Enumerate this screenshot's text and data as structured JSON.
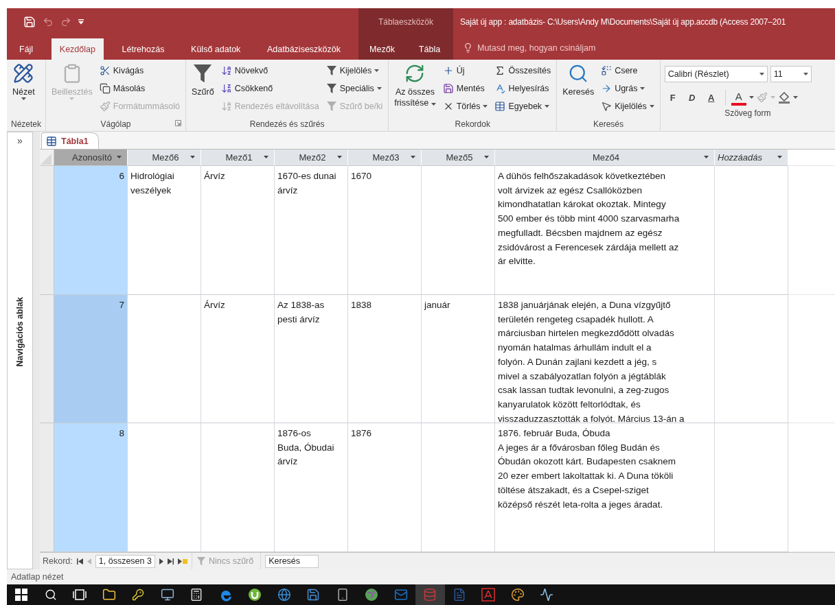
{
  "title_bar": {
    "context_label": "Táblaeszközök",
    "title": "Saját új app : adatbázis- C:\\Users\\Andy M\\Documents\\Saját új app.accdb (Access 2007–201"
  },
  "ribbon_tabs": [
    {
      "label": "Fájl",
      "selected": false,
      "kind": "normal"
    },
    {
      "label": "Kezdőlap",
      "selected": true,
      "kind": "normal"
    },
    {
      "label": "Létrehozás",
      "selected": false,
      "kind": "normal"
    },
    {
      "label": "Külső adatok",
      "selected": false,
      "kind": "normal"
    },
    {
      "label": "Adatbáziseszközök",
      "selected": false,
      "kind": "normal"
    },
    {
      "label": "Mezők",
      "selected": false,
      "kind": "context"
    },
    {
      "label": "Tábla",
      "selected": false,
      "kind": "context"
    }
  ],
  "tell_me": {
    "placeholder": "Mutasd meg, hogyan csináljam"
  },
  "ribbon_groups": [
    {
      "label": "Nézetek",
      "kind": "buttons",
      "launcher": false,
      "items": [
        {
          "label": "Nézet",
          "kind": "large",
          "disabled": false,
          "dropdown": true
        }
      ]
    },
    {
      "label": "Vágólap",
      "kind": "buttons",
      "launcher": true,
      "items": [
        {
          "label": "Beillesztés",
          "kind": "large",
          "disabled": true,
          "dropdown": true
        },
        {
          "label": "Kivágás",
          "kind": "small",
          "disabled": false
        },
        {
          "label": "Másolás",
          "kind": "small",
          "disabled": false
        },
        {
          "label": "Formátummásoló",
          "kind": "small",
          "disabled": true
        }
      ]
    },
    {
      "label": "Rendezés és szűrés",
      "kind": "buttons",
      "launcher": false,
      "items": [
        {
          "label": "Szűrő",
          "kind": "large",
          "disabled": false
        },
        {
          "label": "Növekvő",
          "kind": "small",
          "disabled": false
        },
        {
          "label": "Csökkenő",
          "kind": "small",
          "disabled": false
        },
        {
          "label": "Rendezés eltávolítása",
          "kind": "small",
          "disabled": true
        },
        {
          "label": "Kijelölés",
          "kind": "small",
          "disabled": false,
          "dropdown": true
        },
        {
          "label": "Speciális",
          "kind": "small",
          "disabled": false,
          "dropdown": true
        },
        {
          "label": "Szűrő be/ki",
          "kind": "small",
          "disabled": true
        }
      ]
    },
    {
      "label": "Rekordok",
      "kind": "buttons",
      "launcher": false,
      "items": [
        {
          "label": "Az összes\nfrissítése",
          "kind": "large",
          "disabled": false,
          "dropdown": true
        },
        {
          "label": "Új",
          "kind": "small",
          "disabled": false
        },
        {
          "label": "Mentés",
          "kind": "small",
          "disabled": false
        },
        {
          "label": "Törlés",
          "kind": "small",
          "disabled": false,
          "dropdown": true
        },
        {
          "label": "Összesítés",
          "kind": "small",
          "disabled": false
        },
        {
          "label": "Helyesírás",
          "kind": "small",
          "disabled": false
        },
        {
          "label": "Egyebek",
          "kind": "small",
          "disabled": false,
          "dropdown": true
        }
      ]
    },
    {
      "label": "Keresés",
      "kind": "buttons",
      "launcher": false,
      "items": [
        {
          "label": "Keresés",
          "kind": "large",
          "disabled": false
        },
        {
          "label": "Csere",
          "kind": "small",
          "disabled": false
        },
        {
          "label": "Ugrás",
          "kind": "small",
          "disabled": false,
          "dropdown": true
        },
        {
          "label": "Kijelölés",
          "kind": "small",
          "disabled": false,
          "dropdown": true
        }
      ]
    },
    {
      "label": "Szöveg form",
      "kind": "font",
      "font_name": "Calibri (Részlet)",
      "font_size": "11",
      "format_buttons": [
        "F",
        "D",
        "A"
      ],
      "font_color_label": "A"
    }
  ],
  "navigation_pane": {
    "expand_glyph": "»",
    "label": "Navigációs ablak"
  },
  "document_tab": {
    "label": "Tábla1"
  },
  "table": {
    "columns": [
      {
        "label": "Azonosító",
        "selected": true,
        "kind": "field"
      },
      {
        "label": "Mező6",
        "selected": false,
        "kind": "field"
      },
      {
        "label": "Mező1",
        "selected": false,
        "kind": "field"
      },
      {
        "label": "Mező2",
        "selected": false,
        "kind": "field"
      },
      {
        "label": "Mező3",
        "selected": false,
        "kind": "field"
      },
      {
        "label": "Mező5",
        "selected": false,
        "kind": "field"
      },
      {
        "label": "Mező4",
        "selected": false,
        "kind": "field"
      },
      {
        "label": "Hozzáadás",
        "selected": false,
        "kind": "add"
      }
    ],
    "rows": [
      {
        "selected": false,
        "cells": [
          "6",
          "Hidrológiai\nveszélyek",
          "Árvíz",
          "1670-es dunai\nárvíz",
          "1670",
          null,
          "A dühös felhőszakadások következtében\nvolt árvizek az egész Csallóközben\nkimondhatatlan károkat okoztak. Mintegy\n500 ember és több mint 4000 szarvasmarha\nmegfulladt. Bécsben majdnem az egész\nzsidóvárost a Ferencesek zárdája mellett az\nár elvitte.",
          null
        ]
      },
      {
        "selected": true,
        "cells": [
          "7",
          null,
          "Árvíz",
          "Az 1838-as\npesti árvíz",
          "1838",
          "január",
          "1838 januárjának elején, a Duna vízgyűjtő\nterületén rengeteg csapadék hullott. A\nmárciusban hirtelen megkezdődött olvadás\nnyomán hatalmas árhullám indult el a\nfolyón. A Dunán zajlani kezdett a jég, s\nmivel a szabályozatlan folyón a jégtáblák\ncsak lassan tudtak levonulni, a zeg-zugos\nkanyarulatok között feltorlódtak, és\nvisszaduzzasztották a folyót. Március 13-án a",
          null
        ]
      },
      {
        "selected": false,
        "cells": [
          "8",
          null,
          null,
          "1876-os\nBuda, Óbudai\nárvíz",
          "1876",
          null,
          "1876. február Buda, Óbuda\nA jeges ár a fővárosban főleg Budán és\nÓbudán okozott kárt. Budapesten csaknem\n20 ezer embert lakoltattak ki. A Duna tököli\ntöltése átszakadt, és a Csepel-sziget\nközépső részét leta-rolta a jeges áradat.",
          null
        ]
      }
    ]
  },
  "record_navigation": {
    "label": "Rekord:",
    "position": "1, összesen 3",
    "filter": "Nincs szűrő",
    "search": {
      "placeholder": "Keresés"
    }
  },
  "status_bar": {
    "text": "Adatlap nézet"
  },
  "taskbar": {
    "apps": [
      {
        "selected": false
      },
      {
        "selected": false
      },
      {
        "selected": false
      },
      {
        "selected": false
      },
      {
        "selected": false
      },
      {
        "selected": false
      },
      {
        "selected": false
      },
      {
        "selected": false
      },
      {
        "selected": false
      },
      {
        "selected": false
      },
      {
        "selected": false
      },
      {
        "selected": false
      },
      {
        "selected": false
      },
      {
        "selected": false
      },
      {
        "selected": true
      },
      {
        "selected": false
      },
      {
        "selected": false
      },
      {
        "selected": false
      },
      {
        "selected": false
      }
    ]
  }
}
